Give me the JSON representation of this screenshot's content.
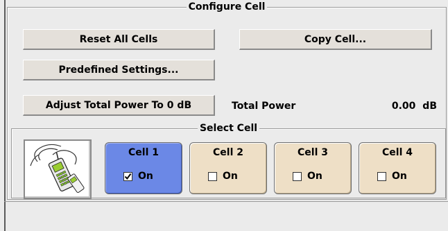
{
  "configure_cell": {
    "title": "Configure Cell",
    "reset_all_label": "Reset All Cells",
    "copy_cell_label": "Copy Cell...",
    "predefined_label": "Predefined Settings...",
    "adjust_power_label": "Adjust Total Power To 0 dB",
    "total_power_label": "Total Power",
    "total_power_value": "0.00",
    "total_power_unit": "dB"
  },
  "select_cell": {
    "title": "Select Cell",
    "icon": "wireless-handset-icon",
    "cells": [
      {
        "label": "Cell 1",
        "on_label": "On",
        "checked": true,
        "selected": true
      },
      {
        "label": "Cell 2",
        "on_label": "On",
        "checked": false,
        "selected": false
      },
      {
        "label": "Cell 3",
        "on_label": "On",
        "checked": false,
        "selected": false
      },
      {
        "label": "Cell 4",
        "on_label": "On",
        "checked": false,
        "selected": false
      }
    ]
  },
  "colors": {
    "selected_cell": "#6b88e6",
    "unselected_cell": "#eedfc6",
    "panel_background": "#ebebeb"
  }
}
